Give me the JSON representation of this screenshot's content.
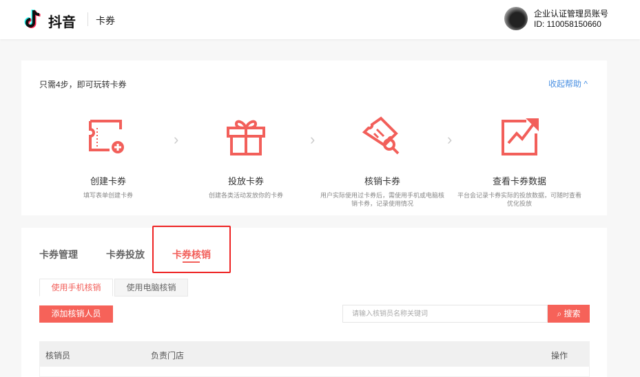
{
  "header": {
    "logo": "抖音",
    "section": "卡券",
    "user_name": "企业认证管理员账号",
    "user_id": "ID: 110058150660"
  },
  "guide": {
    "title": "只需4步，即可玩转卡券",
    "collapse": "收起帮助 ^",
    "steps": [
      {
        "icon": "create-coupon-icon",
        "title": "创建卡券",
        "desc": "填写表单创建卡券"
      },
      {
        "icon": "gift-icon",
        "title": "投放卡券",
        "desc": "创建各类活动发放你的卡券"
      },
      {
        "icon": "verify-coupon-icon",
        "title": "核销卡券",
        "desc": "用户实际使用过卡券后，需使用手机或电脑核销卡券，记录使用情况"
      },
      {
        "icon": "chart-icon",
        "title": "查看卡券数据",
        "desc": "平台会记录卡券实际的投放数据，可随时查看优化投放"
      }
    ]
  },
  "tabs": [
    "卡券管理",
    "卡券投放",
    "卡券核销"
  ],
  "subtabs": [
    "使用手机核销",
    "使用电脑核销"
  ],
  "toolbar": {
    "add": "添加核销人员",
    "search_placeholder": "请输入核销员名称关键词",
    "search": "搜索"
  },
  "table": {
    "columns": [
      "核销员",
      "负责门店",
      "操作"
    ]
  },
  "colors": {
    "accent": "#f25f5a",
    "link": "#4a90e2"
  }
}
